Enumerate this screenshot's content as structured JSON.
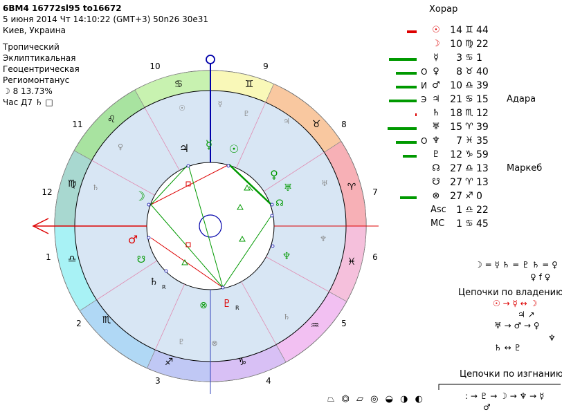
{
  "header": {
    "title": "6BM4 16772sl95 to16672",
    "datetime": "5 июня 2014  Чт  14:10:22 (GMT+3) 50n26  30e31",
    "location": "Киев, Украина",
    "system": [
      "Тропический",
      "Эклиптикальная",
      "Геоцентрическая",
      "Региомонтанус"
    ],
    "moon_phase": "☽  8 13.73%",
    "hour": "Час Д7  ♄ □"
  },
  "chart": {
    "house_numbers": [
      "1",
      "2",
      "3",
      "4",
      "5",
      "6",
      "7",
      "8",
      "9",
      "10",
      "11",
      "12"
    ],
    "zodiac_glyphs": [
      "♈",
      "♉",
      "♊",
      "♋",
      "♌",
      "♍",
      "♎",
      "♏",
      "♐",
      "♑",
      "♒",
      "♓"
    ],
    "sign_colors": [
      "#f7b0b6",
      "#f9c8a0",
      "#f9f8b8",
      "#c8f2b0",
      "#a8e3a0",
      "#a8d8d0",
      "#a8f2f5",
      "#b0d8f5",
      "#c0c8f5",
      "#d8c0f5",
      "#f2c0f2",
      "#f5c0dc"
    ],
    "planet_glyphs": [
      "☉",
      "☽",
      "☿",
      "♀",
      "♂",
      "♃",
      "♄",
      "♅",
      "♆",
      "♇",
      "☊",
      "☋",
      "⊗"
    ],
    "planet_colors": {
      "sun": "#009900",
      "moon": "#009900",
      "mercury": "#009900",
      "venus": "#009900",
      "mars": "#dd0000",
      "jupiter": "#000000",
      "saturn": "#000000",
      "uranus": "#009900",
      "neptune": "#009900",
      "pluto": "#dd0000",
      "node": "#009900",
      "pof": "#009900"
    },
    "retro": "R",
    "accent": "#dd0000"
  },
  "planet_table": {
    "title": "Хорар",
    "rows": [
      {
        "letter": "",
        "glyph": "☉",
        "deg": "14",
        "sign": "♊",
        "min": "44",
        "bar_color": "#dd0000"
      },
      {
        "letter": "",
        "glyph": "☽",
        "deg": "10",
        "sign": "♍",
        "min": "22",
        "bar_color": ""
      },
      {
        "letter": "",
        "glyph": "☿",
        "deg": "3",
        "sign": "♋",
        "min": "1",
        "bar_color": "#009900"
      },
      {
        "letter": "О",
        "glyph": "♀",
        "deg": "8",
        "sign": "♉",
        "min": "40",
        "bar_color": "#009900"
      },
      {
        "letter": "И",
        "glyph": "♂",
        "deg": "10",
        "sign": "♎",
        "min": "39",
        "bar_color": "#009900"
      },
      {
        "letter": "Э",
        "glyph": "♃",
        "deg": "21",
        "sign": "♋",
        "min": "15",
        "bar_color": "#009900"
      },
      {
        "letter": "",
        "glyph": "♄",
        "deg": "18",
        "sign": "♏",
        "min": "12",
        "bar_color": "#dd0000"
      },
      {
        "letter": "",
        "glyph": "♅",
        "deg": "15",
        "sign": "♈",
        "min": "39",
        "bar_color": "#009900"
      },
      {
        "letter": "О",
        "glyph": "♆",
        "deg": "7",
        "sign": "♓",
        "min": "35",
        "bar_color": "#009900"
      },
      {
        "letter": "",
        "glyph": "♇",
        "deg": "12",
        "sign": "♑",
        "min": "59",
        "bar_color": "#009900"
      },
      {
        "letter": "",
        "glyph": "☊",
        "deg": "27",
        "sign": "♎",
        "min": "13",
        "bar_color": ""
      },
      {
        "letter": "",
        "glyph": "☋",
        "deg": "27",
        "sign": "♈",
        "min": "13",
        "bar_color": ""
      },
      {
        "letter": "",
        "glyph": "⊗",
        "deg": "27",
        "sign": "♐",
        "min": "0",
        "bar_color": "#009900"
      },
      {
        "letter": "",
        "glyph": "Asc",
        "deg": "1",
        "sign": "♎",
        "min": "22",
        "bar_color": ""
      },
      {
        "letter": "",
        "glyph": "MC",
        "deg": "1",
        "sign": "♋",
        "min": "45",
        "bar_color": ""
      }
    ],
    "stars": {
      "adara": "Адара",
      "markeb": "Маркеб"
    }
  },
  "dispositors": {
    "line1": "☽ = ☿ ♄ = ♇ ♄ = ♀",
    "line2": "♀ f ♀",
    "title1": "Цепочки по владению",
    "chain1": "☉ → ☿ ↔ ☽",
    "chain1b": "♃ ↗",
    "chain2": "♅ → ♂ → ♀",
    "chain2b": "♆",
    "chain3": "♄ ↔ ♇",
    "title2": "Цепочки по изгнанию",
    "chain4": ": → ♇ → ☽ → ♆ → ☿",
    "chain4b": "♂"
  },
  "bottom_icons": "⏢ ⏣ ⏥  ◎ ◒ ◑ ◐"
}
